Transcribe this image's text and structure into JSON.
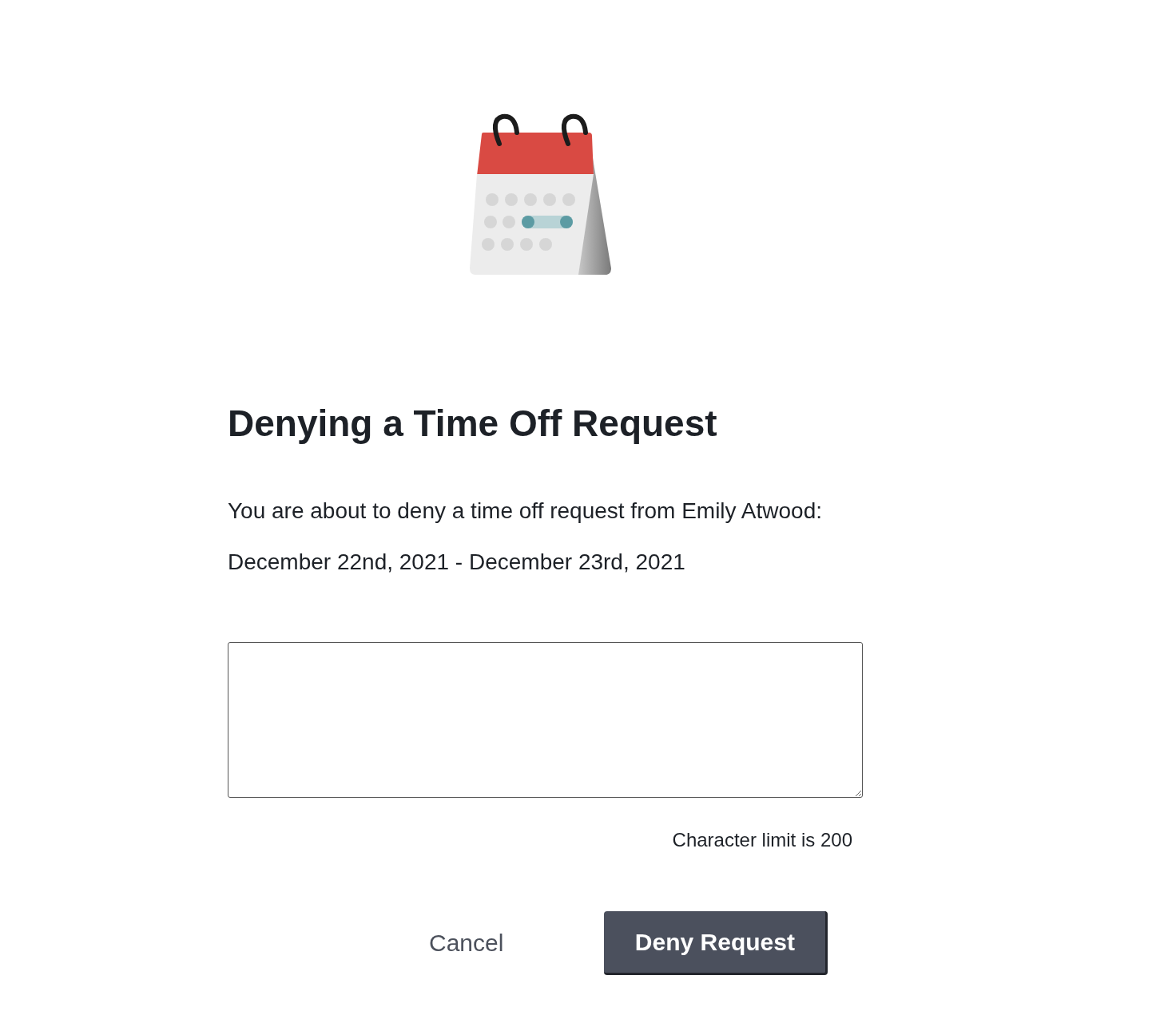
{
  "dialog": {
    "title": "Denying a Time Off Request",
    "message": "You are about to deny a time off request from Emily Atwood: December 22nd, 2021 - December 23rd, 2021",
    "reason_field": {
      "kind": "textarea"
    },
    "hint": "Character limit is 200",
    "buttons": [
      {
        "label": "Cancel",
        "kind": "text"
      },
      {
        "label": "Deny Request",
        "kind": "primary"
      }
    ]
  }
}
